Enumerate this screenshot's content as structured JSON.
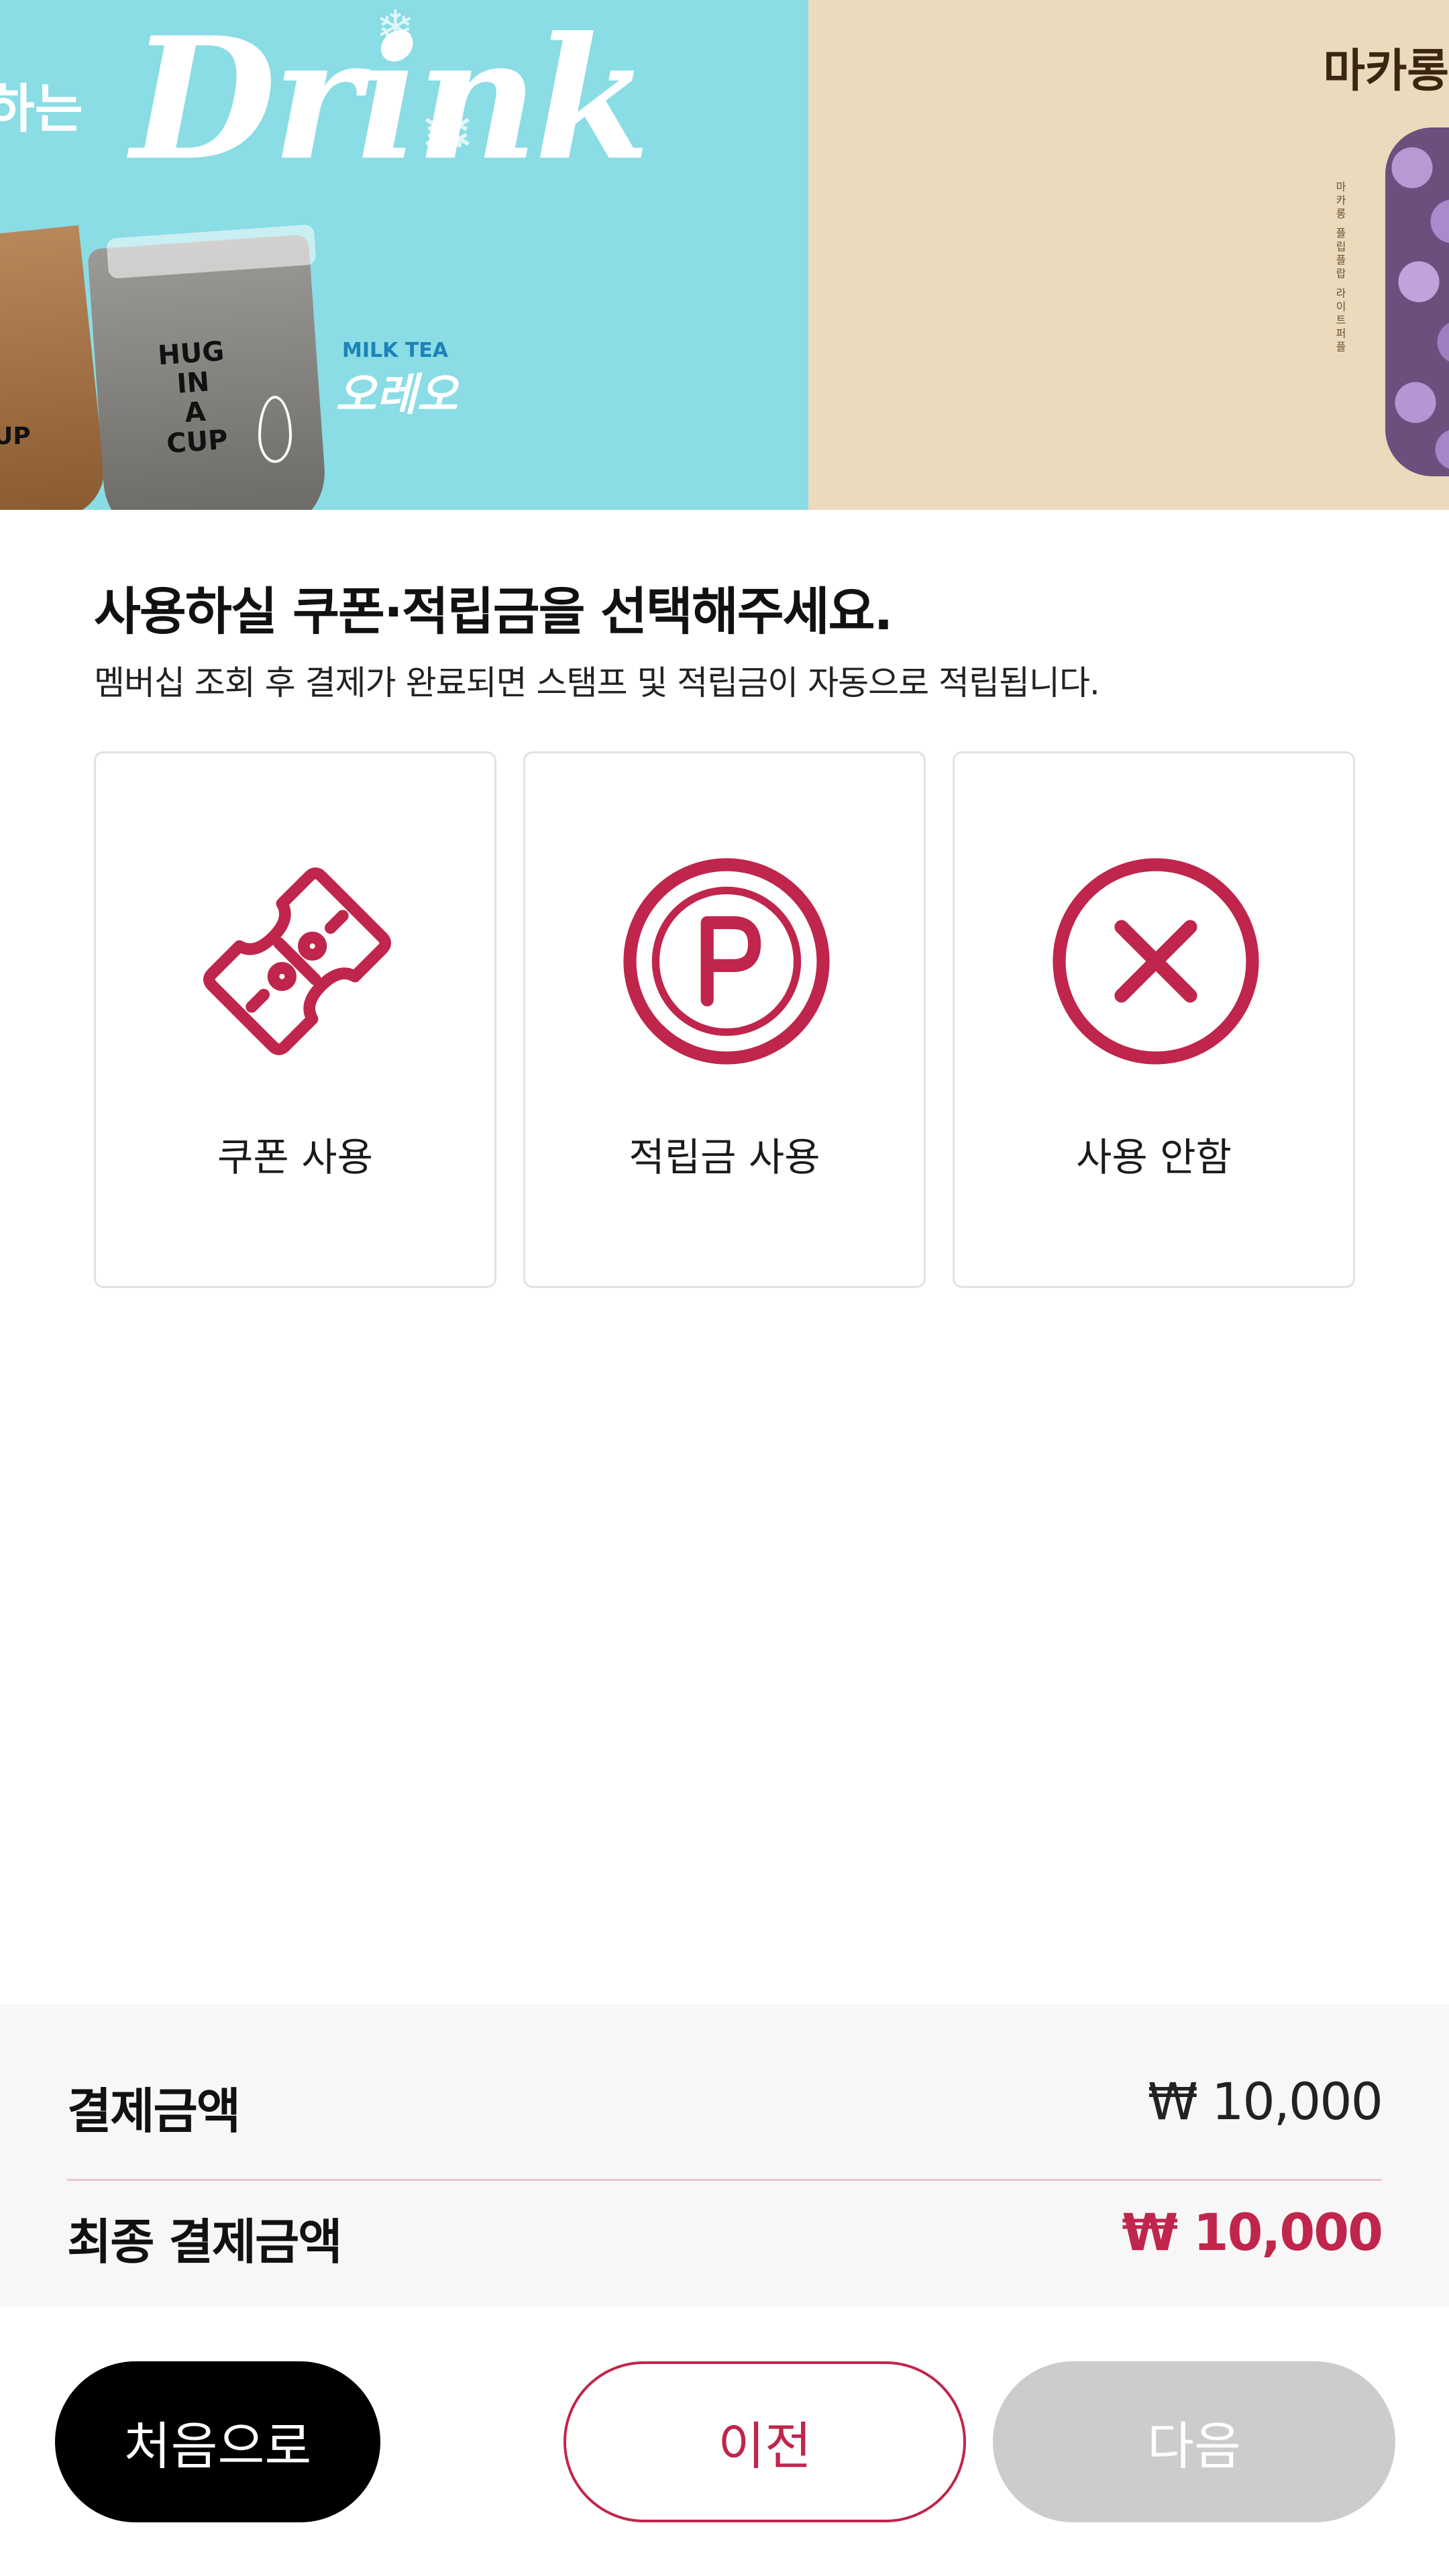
{
  "banner": {
    "drink_prefix": "하는",
    "drink_word": "Drink",
    "cup_label": "HUG\nIN\nA\nCUP",
    "cup_label_left": "UP",
    "milk_tea_label": "MILK TEA",
    "oreo_label": "오레오",
    "macaron_title": "마카롱",
    "macaron_vertical": "마카롱   플립플랍   라이트퍼플"
  },
  "page": {
    "title": "사용하실 쿠폰·적립금을 선택해주세요.",
    "subtitle": "멤버십 조회 후 결제가 완료되면 스탬프 및 적립금이 자동으로 적립됩니다."
  },
  "options": [
    {
      "label": "쿠폰 사용",
      "icon": "coupon-ticket-icon"
    },
    {
      "label": "적립금 사용",
      "icon": "points-p-icon"
    },
    {
      "label": "사용 안함",
      "icon": "cancel-x-icon"
    }
  ],
  "summary": {
    "payment_label": "결제금액",
    "payment_value": "₩ 10,000",
    "final_label": "최종 결제금액",
    "final_value": "₩ 10,000"
  },
  "buttons": {
    "home": "처음으로",
    "prev": "이전",
    "next": "다음"
  },
  "colors": {
    "accent": "#c0254c",
    "banner_left": "#8adce5",
    "banner_right": "#ecdabd",
    "disabled": "#cccccc"
  }
}
